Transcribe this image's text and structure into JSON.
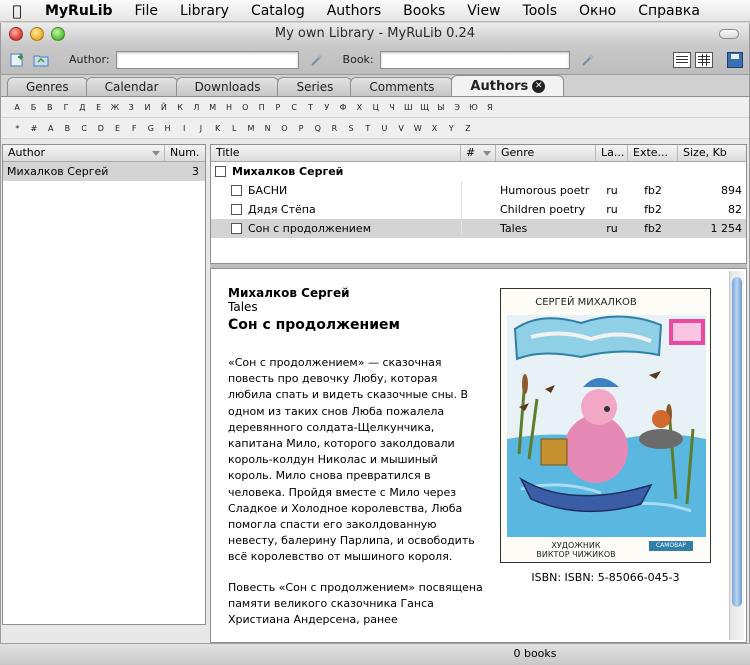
{
  "menubar": {
    "items": [
      "MyRuLib",
      "File",
      "Library",
      "Catalog",
      "Authors",
      "Books",
      "View",
      "Tools",
      "Окно",
      "Справка"
    ]
  },
  "window": {
    "title": "My own Library - MyRuLib 0.24"
  },
  "toolbar": {
    "author_label": "Author:",
    "author_value": "",
    "book_label": "Book:",
    "book_value": ""
  },
  "tabs": [
    "Genres",
    "Calendar",
    "Downloads",
    "Series",
    "Comments",
    "Authors"
  ],
  "alphabet": {
    "cyrillic": [
      "А",
      "Б",
      "В",
      "Г",
      "Д",
      "Е",
      "Ж",
      "З",
      "И",
      "Й",
      "К",
      "Л",
      "М",
      "Н",
      "О",
      "П",
      "Р",
      "С",
      "Т",
      "У",
      "Ф",
      "Х",
      "Ц",
      "Ч",
      "Ш",
      "Щ",
      "Ы",
      "Э",
      "Ю",
      "Я"
    ],
    "latin": [
      "*",
      "#",
      "A",
      "B",
      "C",
      "D",
      "E",
      "F",
      "G",
      "H",
      "I",
      "J",
      "K",
      "L",
      "M",
      "N",
      "O",
      "P",
      "Q",
      "R",
      "S",
      "T",
      "U",
      "V",
      "W",
      "X",
      "Y",
      "Z"
    ]
  },
  "authors": {
    "columns": [
      "Author",
      "Num."
    ],
    "rows": [
      {
        "name": "Михалков Сергей",
        "num": "3"
      }
    ]
  },
  "books": {
    "columns": [
      "Title",
      "#",
      "Genre",
      "La...",
      "Exte...",
      "Size, Kb"
    ],
    "group": "Михалков Сергей",
    "rows": [
      {
        "title": "БАСНИ",
        "num": "",
        "genre": "Humorous poetr",
        "lang": "ru",
        "ext": "fb2",
        "size": "894"
      },
      {
        "title": "Дядя Стёпа",
        "num": "",
        "genre": "Children poetry",
        "lang": "ru",
        "ext": "fb2",
        "size": "82"
      },
      {
        "title": "Сон с продолжением",
        "num": "",
        "genre": "Tales",
        "lang": "ru",
        "ext": "fb2",
        "size": "1 254"
      }
    ]
  },
  "description": {
    "author": "Михалков Сергей",
    "genre": "Tales",
    "title": "Сон с продолжением",
    "annotation": "«Сон с продолжением» — сказочная повесть про девочку Любу, которая любила спать и видеть сказочные сны. В одном из таких снов Люба пожалела деревянного солдата-Щелкунчика, капитана Мило, которого заколдовали король-колдун Николас и мышиный король. Мило снова превратился в человека. Пройдя вместе с Мило через Сладкое и Холодное королевства, Люба помогла спасти его заколдованную невесту, балерину Парлипа, и освободить всё королевство от мышиного короля.",
    "annotation2": "Повесть «Сон с продолжением» посвящена памяти великого сказочника Ганса Христиана Андерсена, ранее",
    "cover_author": "СЕРГЕЙ МИХАЛКОВ",
    "cover_illustrator_label": "ХУДОЖНИК",
    "cover_illustrator": "ВИКТОР ЧИЖИКОВ",
    "cover_publisher": "САМОВАР",
    "isbn": "ISBN: ISBN: 5-85066-045-3"
  },
  "status": {
    "count": "0 books"
  }
}
